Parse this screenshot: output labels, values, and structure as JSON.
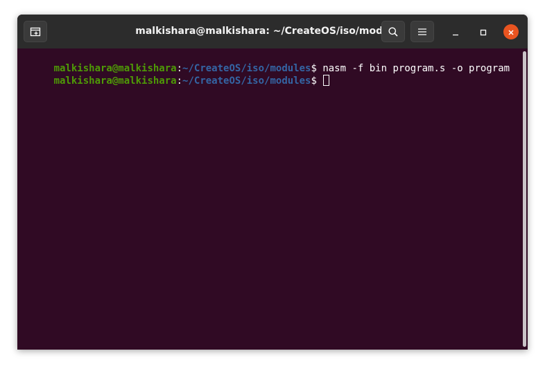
{
  "window": {
    "title": "malkishara@malkishara: ~/CreateOS/iso/modules"
  },
  "titlebar": {
    "new_tab_icon": "new-tab-icon",
    "search_icon": "search-icon",
    "menu_icon": "hamburger-menu-icon",
    "minimize_icon": "minimize-icon",
    "maximize_icon": "maximize-icon",
    "close_icon": "close-icon"
  },
  "terminal": {
    "lines": [
      {
        "user": "malkishara@malkishara",
        "sep": ":",
        "path": "~/CreateOS/iso/modules",
        "prompt": "$ ",
        "command": "nasm -f bin program.s -o program"
      },
      {
        "user": "malkishara@malkishara",
        "sep": ":",
        "path": "~/CreateOS/iso/modules",
        "prompt": "$ ",
        "command": ""
      }
    ]
  },
  "colors": {
    "terminal_bg": "#300a24",
    "titlebar_bg": "#2c2c2c",
    "user_green": "#4e9a06",
    "path_blue": "#3465a4",
    "close_orange": "#e95420"
  }
}
